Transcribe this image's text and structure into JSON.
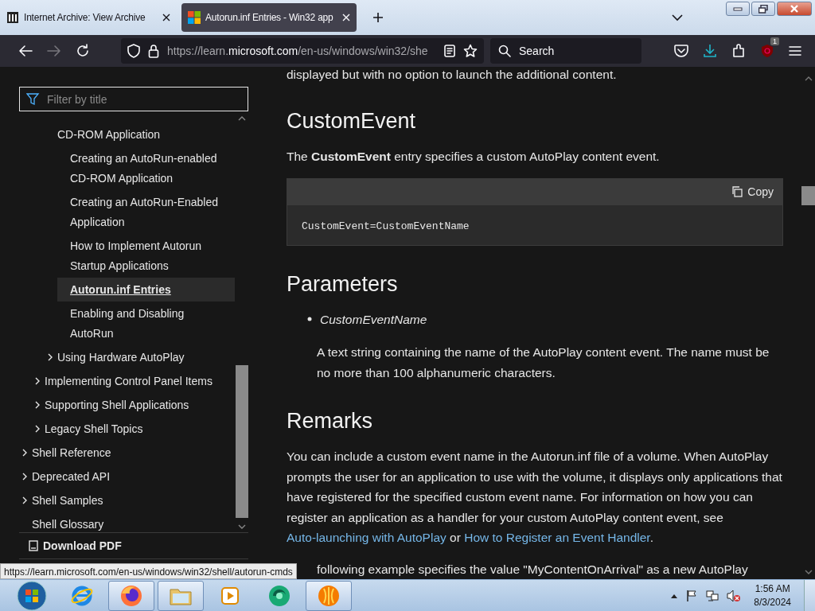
{
  "browser": {
    "tabs": [
      {
        "title": "Internet Archive: View Archive",
        "selected": false
      },
      {
        "title": "Autorun.inf Entries - Win32 app",
        "selected": true
      }
    ],
    "url_prefix": "https://learn.",
    "url_domain": "microsoft.com",
    "url_path": "/en-us/windows/win32/she",
    "search_placeholder": "Search",
    "extension_badge": "1"
  },
  "sidebar": {
    "filter_placeholder": "Filter by title",
    "tree": [
      {
        "children": [
          {
            "children": [
              {
                "label": "CD-ROM Application",
                "kind": "page",
                "selected": false,
                "children": [
                  {
                    "label": "Creating an AutoRun-enabled CD-ROM Application",
                    "kind": "page",
                    "selected": false
                  },
                  {
                    "label": "Creating an AutoRun-Enabled Application",
                    "kind": "page",
                    "selected": false
                  },
                  {
                    "label": "How to Implement Autorun Startup Applications",
                    "kind": "page",
                    "selected": false
                  },
                  {
                    "label": "Autorun.inf Entries",
                    "kind": "page",
                    "selected": true
                  },
                  {
                    "label": "Enabling and Disabling AutoRun",
                    "kind": "page",
                    "selected": false
                  }
                ]
              },
              {
                "label": "Using Hardware AutoPlay",
                "kind": "collapsed",
                "selected": false
              }
            ]
          },
          {
            "label": "Implementing Control Panel Items",
            "kind": "collapsed",
            "selected": false
          },
          {
            "label": "Supporting Shell Applications",
            "kind": "collapsed",
            "selected": false
          },
          {
            "label": "Legacy Shell Topics",
            "kind": "collapsed",
            "selected": false
          }
        ]
      },
      {
        "label": "Shell Reference",
        "kind": "collapsed",
        "selected": false
      },
      {
        "label": "Deprecated API",
        "kind": "collapsed",
        "selected": false
      },
      {
        "label": "Shell Samples",
        "kind": "collapsed",
        "selected": false
      },
      {
        "label": "Shell Glossary",
        "kind": "page",
        "selected": false
      }
    ],
    "download_label": "Download PDF"
  },
  "article": {
    "cut_line": "displayed but with no option to launch the additional content.",
    "blocks": [
      {
        "kind": "heading",
        "text": "CustomEvent"
      },
      {
        "kind": "paragraph",
        "parts": [
          {
            "kind": "text",
            "text": "The **CustomEvent** entry specifies a custom AutoPlay content event."
          }
        ]
      },
      {
        "kind": "code",
        "copy_label": "Copy",
        "code": "CustomEvent=CustomEventName"
      },
      {
        "kind": "heading",
        "text": "Parameters"
      },
      {
        "kind": "term",
        "text": "CustomEventName"
      },
      {
        "kind": "description",
        "text": "A text string containing the name of the AutoPlay content event. The name must be no more than 100 alphanumeric characters."
      },
      {
        "kind": "heading",
        "text": "Remarks"
      },
      {
        "kind": "paragraph",
        "parts": [
          {
            "kind": "text",
            "text": "You can include a custom event name in the Autorun.inf file of a volume. When AutoPlay prompts the user for an application to use with the volume, it displays only applications that have registered for the specified custom event name. For information on how you can register an application as a handler for your custom AutoPlay content event, see "
          },
          {
            "kind": "link",
            "text": "Auto-launching with AutoPlay"
          },
          {
            "kind": "text",
            "text": " or "
          },
          {
            "kind": "link",
            "text": "How to Register an Event Handler"
          },
          {
            "kind": "text",
            "text": "."
          }
        ]
      },
      {
        "kind": "cut",
        "text": "following example specifies the value \"MyContentOnArrival\" as a new AutoPlay"
      }
    ]
  },
  "status_url": "https://learn.microsoft.com/en-us/windows/win32/shell/autorun-cmds",
  "taskbar": {
    "apps": [
      {
        "kind": "ie",
        "running": false
      },
      {
        "kind": "firefox",
        "running": true
      },
      {
        "kind": "explorer",
        "running": true
      },
      {
        "kind": "media",
        "running": false
      },
      {
        "kind": "green",
        "running": false
      },
      {
        "kind": "orange",
        "running": true
      }
    ],
    "time": "1:56 AM",
    "date": "8/3/2024"
  }
}
